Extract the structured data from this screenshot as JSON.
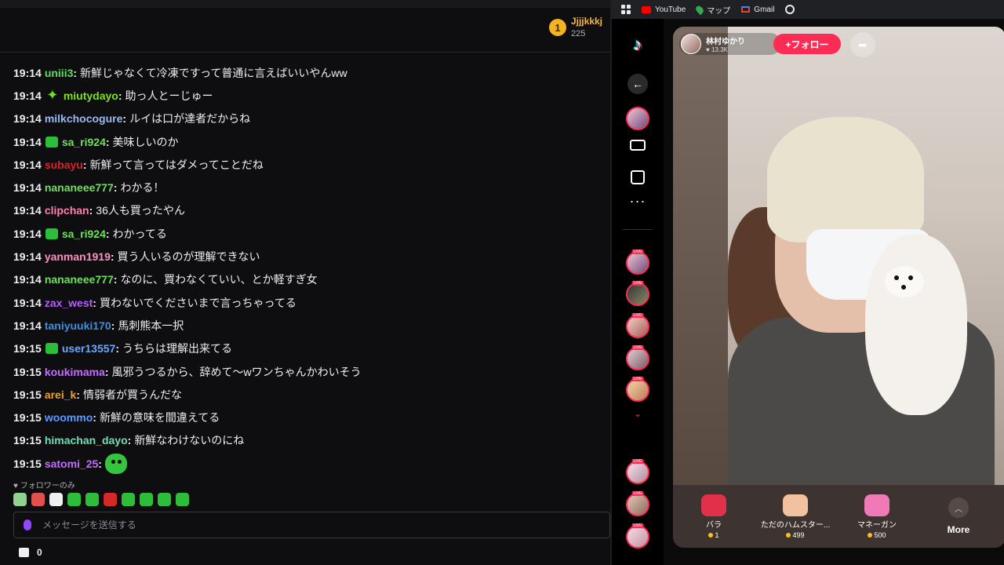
{
  "leaderboard": {
    "rank": "1",
    "name": "Jjjjkkkj",
    "points": "225"
  },
  "messages": [
    {
      "time": "19:14",
      "user": "uniii3",
      "color": "#5ce05c",
      "badge": "",
      "text": "新鮮じゃなくて冷凍ですって普通に言えばいいやんww"
    },
    {
      "time": "19:14",
      "user": "miutydayo",
      "color": "#7ee024",
      "badge": "spark-badge-icon",
      "text": "助っ人とーじゅー"
    },
    {
      "time": "19:14",
      "user": "milkchocogure",
      "color": "#9ab8f4",
      "badge": "",
      "text": "ルイは口が達者だからね"
    },
    {
      "time": "19:14",
      "user": "sa_ri924",
      "color": "#6ee05a",
      "badge": "gift-badge-icon",
      "text": "美味しいのか"
    },
    {
      "time": "19:14",
      "user": "subayu",
      "color": "#d6242e",
      "badge": "",
      "text": "新鮮って言ってはダメってことだね"
    },
    {
      "time": "19:14",
      "user": "nananeee777",
      "color": "#6ee05a",
      "badge": "",
      "text": "わかる！"
    },
    {
      "time": "19:14",
      "user": "clipchan",
      "color": "#ff7fb4",
      "badge": "",
      "text": "36人も買ったやん"
    },
    {
      "time": "19:14",
      "user": "sa_ri924",
      "color": "#6ee05a",
      "badge": "gift-badge-icon",
      "text": "わかってる"
    },
    {
      "time": "19:14",
      "user": "yanman1919",
      "color": "#ff8fc0",
      "badge": "",
      "text": "買う人いるのが理解できない"
    },
    {
      "time": "19:14",
      "user": "nananeee777",
      "color": "#6ee05a",
      "badge": "",
      "text": "なのに、買わなくていい、とか軽すぎ女"
    },
    {
      "time": "19:14",
      "user": "zax_west",
      "color": "#b45cff",
      "badge": "",
      "text": "買わないでくださいまで言っちゃってる"
    },
    {
      "time": "19:14",
      "user": "taniyuuki170",
      "color": "#3c8fe0",
      "badge": "",
      "text": "馬刺熊本一択"
    },
    {
      "time": "19:15",
      "user": "user13557",
      "color": "#6aa8ff",
      "badge": "gift-badge-icon",
      "text": "うちらは理解出来てる"
    },
    {
      "time": "19:15",
      "user": "koukimama",
      "color": "#c56cff",
      "badge": "",
      "text": "風邪うつるから、辞めて〜wワンちゃんかわいそう"
    },
    {
      "time": "19:15",
      "user": "arei_k",
      "color": "#f0a020",
      "badge": "",
      "text": "情弱者が買うんだな"
    },
    {
      "time": "19:15",
      "user": "woommo",
      "color": "#5c9aff",
      "badge": "",
      "text": "新鮮の意味を間違えてる"
    },
    {
      "time": "19:15",
      "user": "himachan_dayo",
      "color": "#6ee0b0",
      "badge": "",
      "text": "新鮮なわけないのにね"
    },
    {
      "time": "19:15",
      "user": "satomi_25",
      "color": "#c56cff",
      "badge": "",
      "text": "",
      "emote": "green-blob-emote"
    }
  ],
  "chat": {
    "followers_only": "フォロワーのみ",
    "input_placeholder": "メッセージを送信する",
    "channel_points": "0"
  },
  "emote_colors": [
    "#8fd18f",
    "#e05050",
    "#f0f0f0",
    "#2ebd3a",
    "#2ebd3a",
    "#d62828",
    "#2ebd3a",
    "#2ebd3a",
    "#2ebd3a",
    "#2ebd3a"
  ],
  "bookmarks": {
    "youtube": "YouTube",
    "maps": "マップ",
    "gmail": "Gmail"
  },
  "live": {
    "host_name": "林村ゆかり",
    "likes": "13.3K",
    "follow_label": "+フォロー",
    "gifts": [
      {
        "name": "バラ",
        "price": "1",
        "color": "#e0304a"
      },
      {
        "name": "ただのハムスター...",
        "price": "499",
        "color": "#f2c1a0"
      },
      {
        "name": "マネーガン",
        "price": "500",
        "color": "#f07ab8"
      }
    ],
    "more_label": "More"
  }
}
